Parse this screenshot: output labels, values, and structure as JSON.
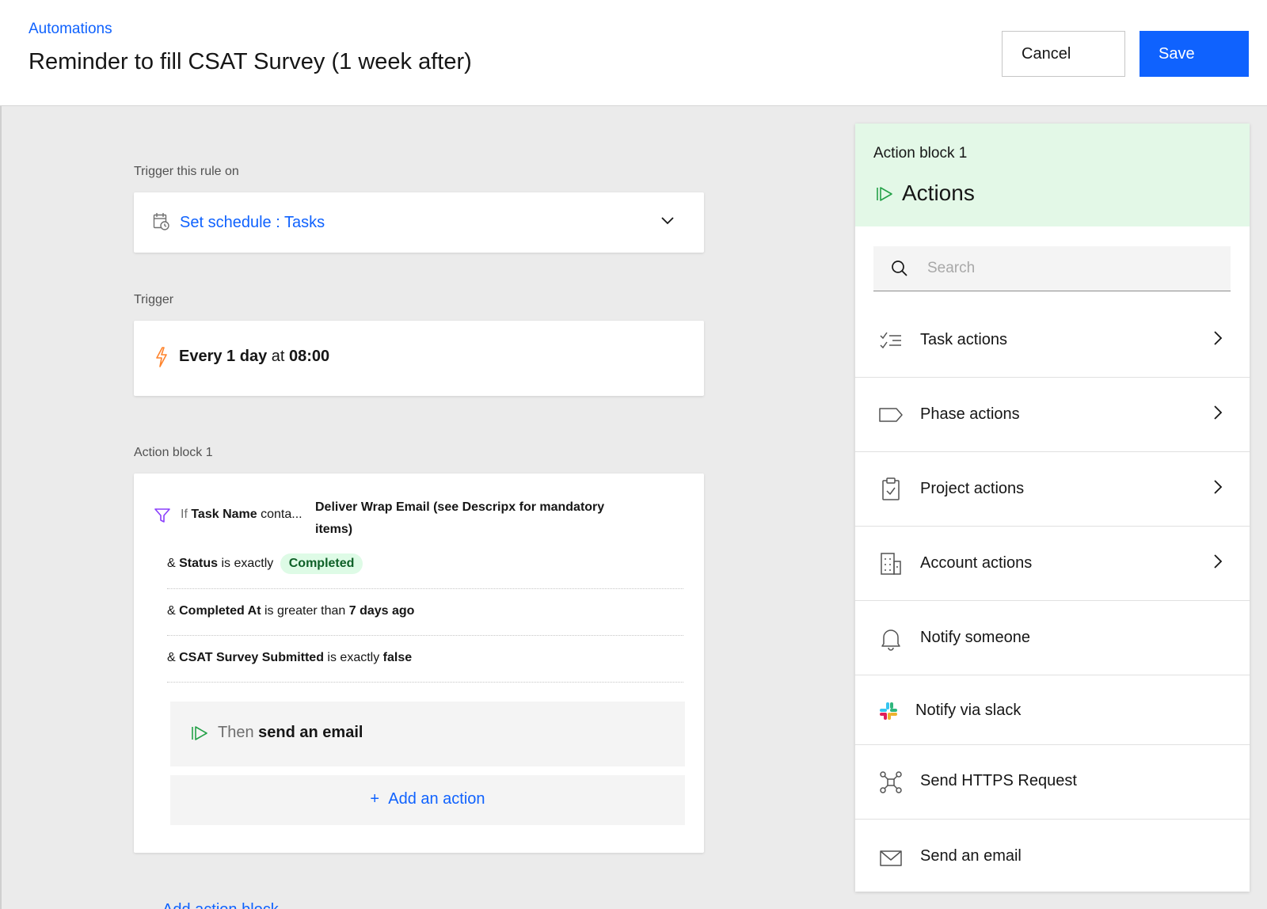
{
  "header": {
    "breadcrumb": "Automations",
    "title": "Reminder to fill CSAT Survey (1 week after)",
    "cancel_label": "Cancel",
    "save_label": "Save"
  },
  "trigger_on": {
    "label": "Trigger this rule on",
    "value": "Set schedule : Tasks",
    "icon": "calendar-clock-icon"
  },
  "trigger": {
    "label": "Trigger",
    "frequency": "Every 1 day",
    "at_word": "at",
    "time": "08:00",
    "icon": "lightning-icon"
  },
  "action_block": {
    "label": "Action block 1",
    "condition_if": "If",
    "condition_field": "Task Name",
    "condition_op": "conta...",
    "condition_value_line1": "Deliver Wrap Email (see Descripx for mandatory",
    "condition_value_line2": "items)",
    "conditions": [
      {
        "prefix": "&",
        "field": "Status",
        "op": "is exactly",
        "value": "Completed"
      },
      {
        "prefix": "&",
        "field": "Completed At",
        "op": "is greater than",
        "value": "7 days ago"
      },
      {
        "prefix": "&",
        "field": "CSAT Survey Submitted",
        "op": "is exactly",
        "value": "false"
      }
    ],
    "then_word": "Then",
    "then_action": "send an email",
    "add_action": "Add an action",
    "add_symbol": "+"
  },
  "bottom_peek": "Add action block",
  "side_panel": {
    "subtitle": "Action block 1",
    "title": "Actions",
    "search_placeholder": "Search",
    "items": [
      {
        "label": "Task actions",
        "icon": "checklist-icon",
        "has_chevron": true
      },
      {
        "label": "Phase actions",
        "icon": "tag-icon",
        "has_chevron": true
      },
      {
        "label": "Project actions",
        "icon": "clipboard-icon",
        "has_chevron": true
      },
      {
        "label": "Account actions",
        "icon": "building-icon",
        "has_chevron": true
      },
      {
        "label": "Notify someone",
        "icon": "bell-icon",
        "has_chevron": false
      },
      {
        "label": "Notify via slack",
        "icon": "slack-icon",
        "has_chevron": false
      },
      {
        "label": "Send HTTPS Request",
        "icon": "network-icon",
        "has_chevron": false
      },
      {
        "label": "Send an email",
        "icon": "envelope-icon",
        "has_chevron": false
      }
    ]
  },
  "colors": {
    "primary": "#0f62fe",
    "panel_header_bg": "#e3f8e7",
    "badge_bg": "#defbe6",
    "badge_text": "#0e6027",
    "filter_icon": "#8a3ffc",
    "lightning_icon": "#ff832b",
    "play_icon": "#24a148"
  }
}
